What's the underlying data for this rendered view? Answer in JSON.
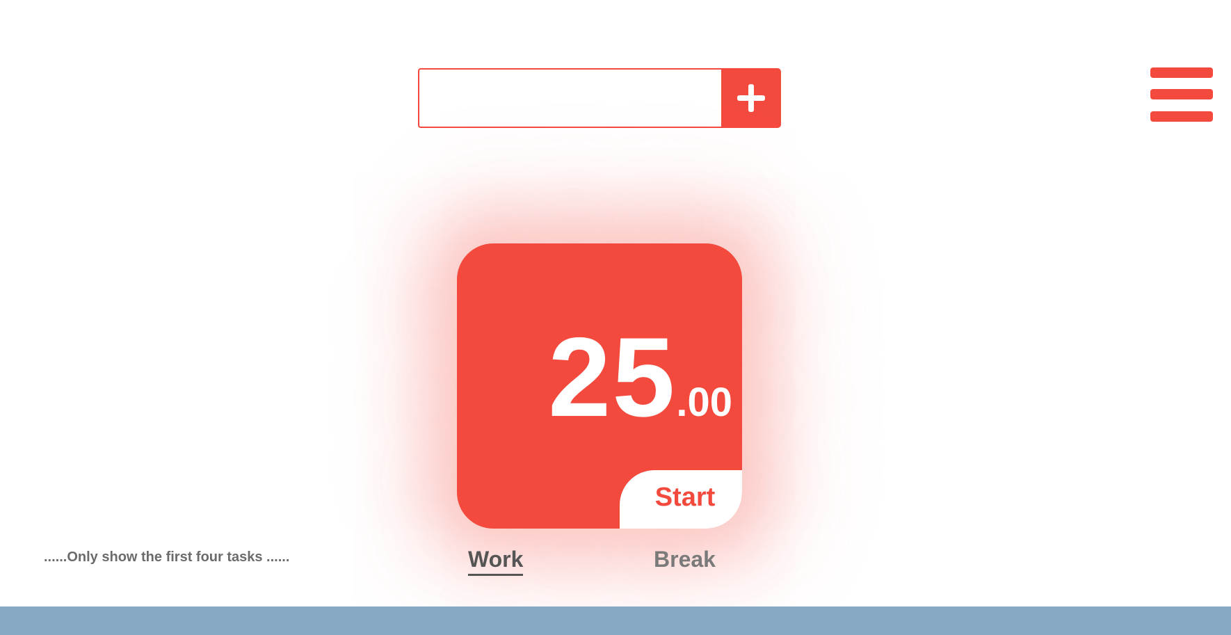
{
  "task_input": {
    "value": "",
    "placeholder": ""
  },
  "add_button": {
    "icon": "plus-icon"
  },
  "menu": {
    "icon": "hamburger-menu-icon"
  },
  "timer": {
    "minutes": "25",
    "seconds": ".00",
    "start_label": "Start"
  },
  "modes": {
    "work_label": "Work",
    "break_label": "Break",
    "active": "Work"
  },
  "hint": "......Only show the first four tasks ......",
  "colors": {
    "accent": "#f44a3d",
    "tab_text": "#7a7a7a",
    "bottom_bar": "#87a9c4"
  }
}
